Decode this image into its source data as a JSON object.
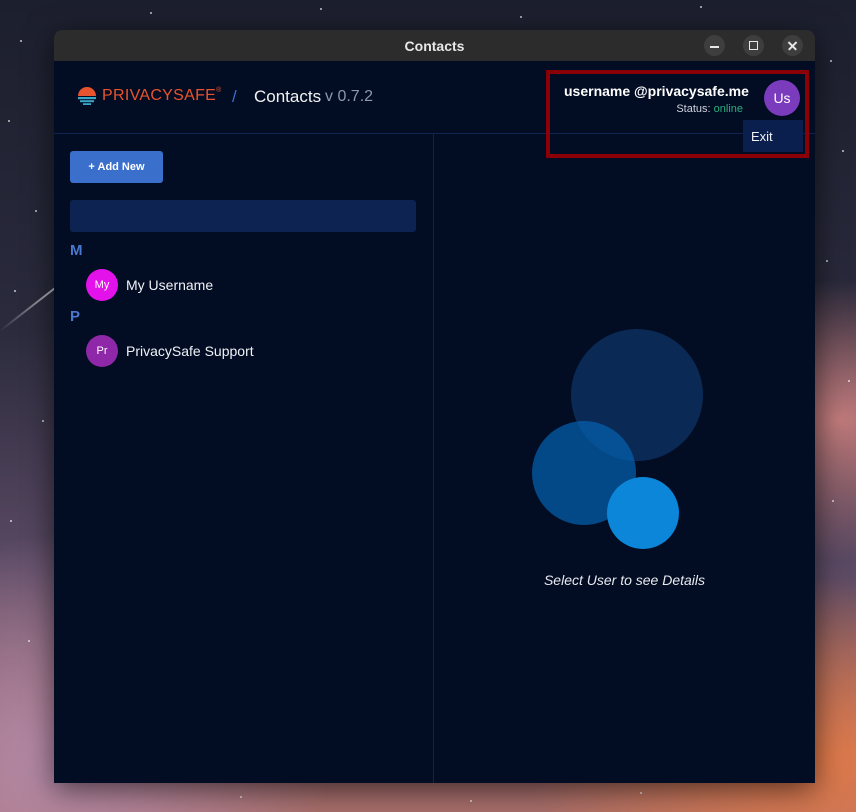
{
  "window": {
    "title": "Contacts"
  },
  "header": {
    "brand": "PRIVACYSAFE",
    "brand_mark": "®",
    "separator": "/",
    "app_title": "Contacts",
    "version": "v 0.7.2"
  },
  "user": {
    "name": "username @privacysafe.me",
    "status_label": "Status:",
    "status_value": "online",
    "avatar_initials": "Us",
    "menu": {
      "exit_label": "Exit"
    }
  },
  "contacts": {
    "add_new_label": "+ Add New",
    "search_value": "",
    "groups": [
      {
        "letter": "M",
        "items": [
          {
            "initials": "My",
            "name": "My Username",
            "color": "#e312ea"
          }
        ]
      },
      {
        "letter": "P",
        "items": [
          {
            "initials": "Pr",
            "name": "PrivacySafe Support",
            "color": "#8e27a8"
          }
        ]
      }
    ]
  },
  "details": {
    "empty_message": "Select User to see Details"
  },
  "colors": {
    "background": "#020c22",
    "accent": "#3a6fcc",
    "brand": "#e8542d",
    "status_online": "#27b081",
    "highlight_box": "#8a0006"
  },
  "icons": [
    "minimize-icon",
    "maximize-icon",
    "close-icon",
    "privacysafe-logo-icon"
  ]
}
